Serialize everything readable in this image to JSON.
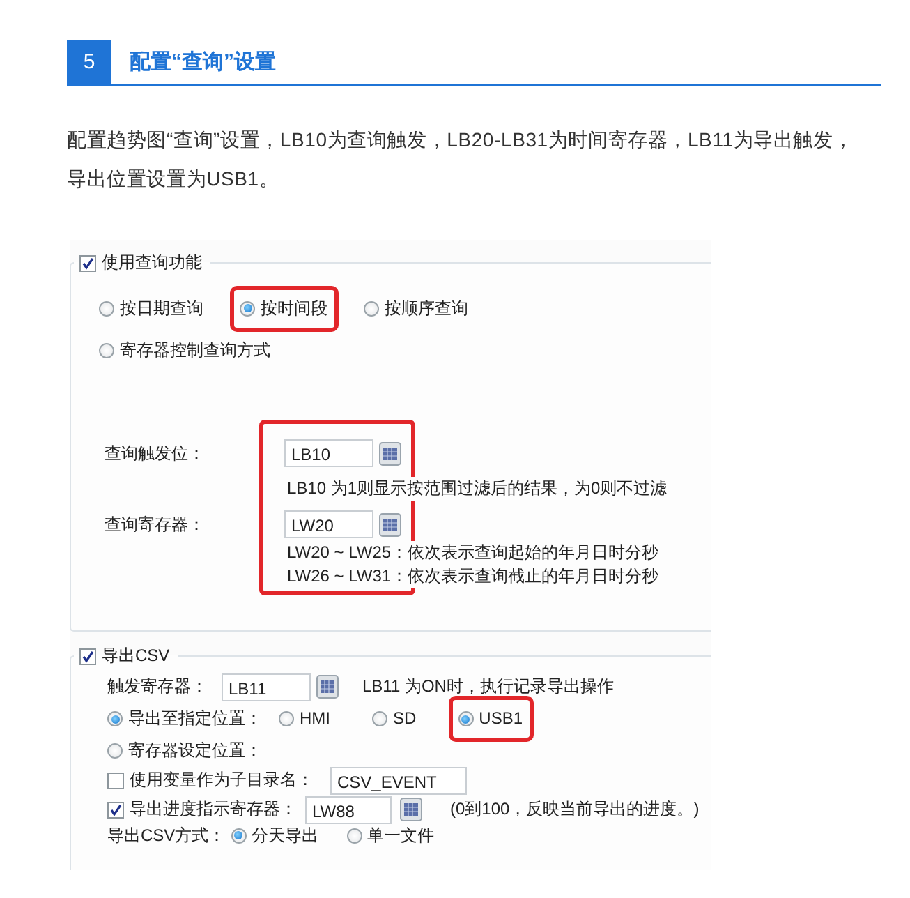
{
  "section": {
    "number": "5",
    "title": "配置“查询”设置"
  },
  "intro": "配置趋势图“查询”设置，LB10为查询触发，LB20-LB31为时间寄存器，LB11为导出触发，导出位置设置为USB1。",
  "query_group": {
    "label": "使用查询功能",
    "checked": true,
    "mode_rows": [
      [
        {
          "label": "按日期查询",
          "selected": false,
          "highlighted": false
        },
        {
          "label": "按时间段",
          "selected": true,
          "highlighted": true
        },
        {
          "label": "按顺序查询",
          "selected": false,
          "highlighted": false
        }
      ],
      [
        {
          "label": "寄存器控制查询方式",
          "selected": false,
          "highlighted": false
        }
      ]
    ],
    "fields_highlighted": true,
    "trigger": {
      "label": "查询触发位：",
      "value": "LB10",
      "hints": [
        "LB10 为1则显示按范围过滤后的结果，为0则不过滤"
      ]
    },
    "register": {
      "label": "查询寄存器：",
      "value": "LW20",
      "hints": [
        "LW20 ~ LW25：依次表示查询起始的年月日时分秒",
        "LW26 ~ LW31：依次表示查询截止的年月日时分秒"
      ]
    }
  },
  "export_group": {
    "label": "导出CSV",
    "checked": true,
    "trigger": {
      "label": "触发寄存器：",
      "value": "LB11",
      "hint": "LB11 为ON时，执行记录导出操作"
    },
    "location": {
      "label": "导出至指定位置：",
      "selected": true,
      "targets": [
        {
          "label": "HMI",
          "selected": false,
          "highlighted": false
        },
        {
          "label": "SD",
          "selected": false,
          "highlighted": false
        },
        {
          "label": "USB1",
          "selected": true,
          "highlighted": true
        }
      ]
    },
    "register_location": {
      "label": "寄存器设定位置：",
      "selected": false
    },
    "subdir": {
      "label": "使用变量作为子目录名：",
      "checked": false,
      "value": "CSV_EVENT"
    },
    "progress": {
      "label": "导出进度指示寄存器：",
      "checked": true,
      "value": "LW88",
      "hint": "(0到100，反映当前导出的进度。)"
    },
    "mode": {
      "label": "导出CSV方式：",
      "options": [
        {
          "label": "分天导出",
          "selected": true
        },
        {
          "label": "单一文件",
          "selected": false
        }
      ]
    }
  }
}
